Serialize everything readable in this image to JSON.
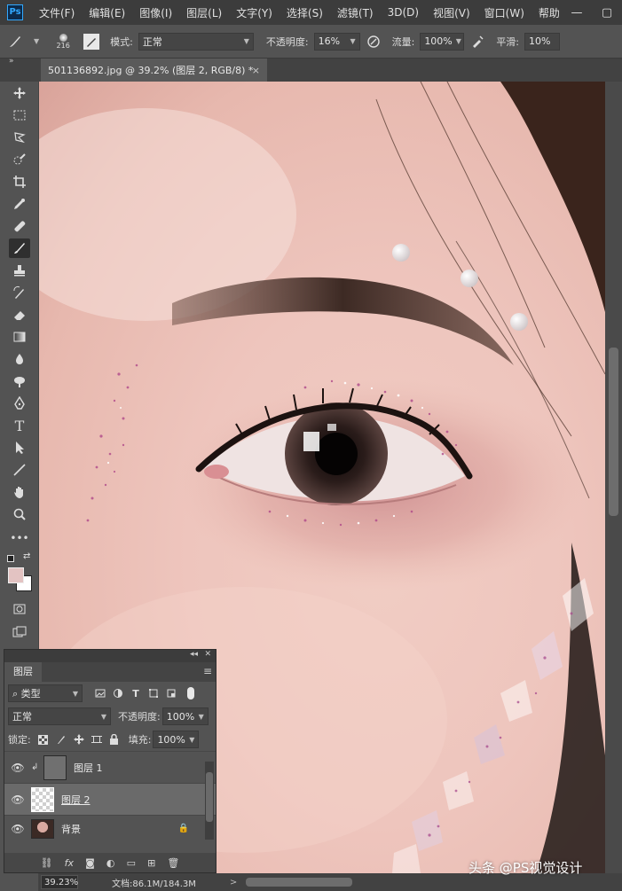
{
  "app": {
    "logo": "Ps"
  },
  "menu": [
    "文件(F)",
    "编辑(E)",
    "图像(I)",
    "图层(L)",
    "文字(Y)",
    "选择(S)",
    "滤镜(T)",
    "3D(D)",
    "视图(V)",
    "窗口(W)",
    "帮助"
  ],
  "window_controls": {
    "minimize": "—",
    "restore": "▢",
    "close": "✕"
  },
  "options": {
    "brush_size": "216",
    "mode_label": "模式:",
    "mode_value": "正常",
    "opacity_label": "不透明度:",
    "opacity_value": "16%",
    "flow_label": "流量:",
    "flow_value": "100%",
    "smoothing_label": "平滑:",
    "smoothing_value": "10%"
  },
  "document": {
    "tab_title": "501136892.jpg @ 39.2% (图层 2, RGB/8) *",
    "tab_close": "×"
  },
  "tools": [
    "move-icon",
    "marquee-icon",
    "lasso-icon",
    "quick-selection-icon",
    "crop-icon",
    "eyedropper-icon",
    "healing-icon",
    "brush-icon",
    "stamp-icon",
    "history-brush-icon",
    "eraser-icon",
    "gradient-icon",
    "blur-icon",
    "dodge-icon",
    "pen-icon",
    "type-icon",
    "path-selection-icon",
    "line-icon",
    "hand-icon",
    "zoom-icon",
    "more-icon"
  ],
  "colors": {
    "foreground": "#e3c3c2",
    "background": "#ffffff",
    "accent": "#31a8ff"
  },
  "status": {
    "zoom": "39.23%",
    "doc_info": "文档:86.1M/184.3M",
    "arrow": ">"
  },
  "watermark": "头条 @PS视觉设计",
  "layers_panel": {
    "title": "图层",
    "filter_kind": "类型",
    "blend_mode": "正常",
    "opacity_label": "不透明度:",
    "opacity_value": "100%",
    "lock_label": "锁定:",
    "fill_label": "填充:",
    "fill_value": "100%",
    "layers": [
      {
        "name": "图层 1",
        "visible": true,
        "clipped": true,
        "selected": false
      },
      {
        "name": "图层 2",
        "visible": true,
        "clipped": false,
        "selected": true
      },
      {
        "name": "背景",
        "visible": true,
        "clipped": false,
        "selected": false,
        "locked": true
      }
    ],
    "footer_icons": [
      "link-icon",
      "fx-icon",
      "mask-icon",
      "adjustment-icon",
      "group-icon",
      "new-layer-icon",
      "delete-icon"
    ]
  }
}
